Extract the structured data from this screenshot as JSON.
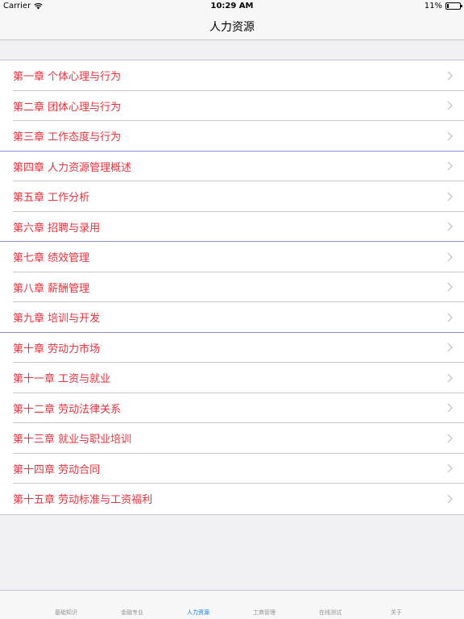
{
  "status_bar": {
    "carrier": "Carrier",
    "time": "10:29 AM",
    "battery": "11%",
    "battery_level": 0.11
  },
  "nav": {
    "title": "人力资源"
  },
  "chapters": [
    "第一章 个体心理与行为",
    "第二章 团体心理与行为",
    "第三章 工作态度与行为",
    "第四章 人力资源管理概述",
    "第五章 工作分析",
    "第六章 招聘与录用",
    "第七章 绩效管理",
    "第八章 薪酬管理",
    "第九章 培训与开发",
    "第十章 劳动力市场",
    "第十一章 工资与就业",
    "第十二章 劳动法律关系",
    "第十三章 就业与职业培训",
    "第十四章 劳动合同",
    "第十五章 劳动标准与工资福利"
  ],
  "tabs": [
    {
      "label": "基础知识",
      "active": false
    },
    {
      "label": "金融专业",
      "active": false
    },
    {
      "label": "人力资源",
      "active": true
    },
    {
      "label": "工商管理",
      "active": false
    },
    {
      "label": "在线测试",
      "active": false
    },
    {
      "label": "关于",
      "active": false
    }
  ],
  "colors": {
    "chapter_text": "#e8323d",
    "tab_active": "#007aff",
    "tab_inactive": "#929292",
    "accent_separator": "#8f8fd8"
  }
}
